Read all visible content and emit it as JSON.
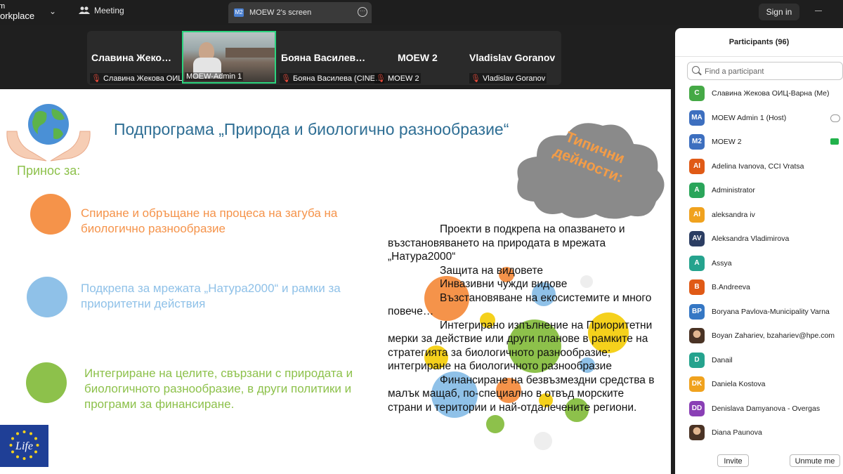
{
  "app": {
    "brand_line1": "m",
    "brand_line2": "orkplace",
    "meeting_tab_label": "Meeting",
    "screen_tab_badge": "M2",
    "screen_tab_label": "MOEW 2's screen",
    "sign_in_label": "Sign in"
  },
  "video_strip": {
    "tiles": [
      {
        "name": "Славина Жеко…",
        "sub": "Славина Жекова ОИЦ…"
      },
      {
        "name": "",
        "sub": "MOEW-Admin 1"
      },
      {
        "name": "Бояна Василев…",
        "sub": "Бояна Василева (CINE…"
      },
      {
        "name": "MOEW 2",
        "sub": "MOEW 2"
      },
      {
        "name": "Vladislav Goranov",
        "sub": "Vladislav Goranov"
      }
    ]
  },
  "slide": {
    "title": "Подпрограма „Природа и биологично разнообразие“",
    "contribution_label": "Принос за:",
    "items": [
      {
        "text": "Спиране и обръщане на процеса на загуба на биологично разнообразие",
        "color": "#f5934a"
      },
      {
        "text": "Подкрепа за мрежата „Натура2000“ и рамки за приоритетни действия",
        "color": "#8fc1e8"
      },
      {
        "text": "Интегриране на целите, свързани с природата и биологичното разнообразие, в други политики и програми за финансиране.",
        "color": "#8dc14b"
      }
    ],
    "cloud_text": "Типични дейности:",
    "body": [
      {
        "text": "Проекти в подкрепа на опазването и възстановяването на природата в мрежата „Натура2000“",
        "indent": true
      },
      {
        "text": "Защита на видовете",
        "indent": true
      },
      {
        "text": "Инвазивни чужди видове",
        "indent": true
      },
      {
        "text": "Възстановяване на екосистемите и много повече…",
        "indent": true
      },
      {
        "text": "Интегрирано изпълнение на Приоритетни мерки за действие или други планове в рамките на стратегията за биологичното разнообразие; интегриране на биологичното разнообразие",
        "indent": true
      },
      {
        "text": "Финансиране на безвъзмездни средства в малък мащаб, по-специално в отвъд морските страни и територии и най-отдалечените региони.",
        "indent": true
      }
    ],
    "eu_logo_text": "Life"
  },
  "participants": {
    "title": "Participants (96)",
    "search_placeholder": "Find a participant",
    "list": [
      {
        "initials": "C",
        "name": "Славина Жекова ОИЦ-Варна (Me)",
        "color": "#45a946",
        "status": ""
      },
      {
        "initials": "MA",
        "name": "MOEW Admin 1 (Host)",
        "color": "#3d6fbf",
        "status": "cloud"
      },
      {
        "initials": "M2",
        "name": "MOEW 2",
        "color": "#3d6fbf",
        "status": "share"
      },
      {
        "initials": "AI",
        "name": "Adelina Ivanova, CCI Vratsa",
        "color": "#e05a16",
        "status": ""
      },
      {
        "initials": "A",
        "name": "Administrator",
        "color": "#2aa55a",
        "status": ""
      },
      {
        "initials": "AI",
        "name": "aleksandra iv",
        "color": "#f0a21e",
        "status": ""
      },
      {
        "initials": "AV",
        "name": "Aleksandra Vladimirova",
        "color": "#2c3e63",
        "status": ""
      },
      {
        "initials": "A",
        "name": "Assya",
        "color": "#25a38e",
        "status": ""
      },
      {
        "initials": "B",
        "name": "B.Andreeva",
        "color": "#e05a16",
        "status": ""
      },
      {
        "initials": "BP",
        "name": "Boryana Pavlova-Municipality Varna",
        "color": "#3577c4",
        "status": ""
      },
      {
        "initials": "",
        "name": "Boyan Zahariev, bzahariev@hpe.com",
        "color": "",
        "status": "",
        "photo": true
      },
      {
        "initials": "D",
        "name": "Danail",
        "color": "#25a38e",
        "status": ""
      },
      {
        "initials": "DK",
        "name": "Daniela Kostova",
        "color": "#f0a21e",
        "status": ""
      },
      {
        "initials": "DD",
        "name": "Denislava Damyanova - Overgas",
        "color": "#8a3fb5",
        "status": ""
      },
      {
        "initials": "",
        "name": "Diana Paunova",
        "color": "",
        "status": "",
        "photo": true
      }
    ],
    "invite_label": "Invite",
    "unmute_label": "Unmute me"
  }
}
